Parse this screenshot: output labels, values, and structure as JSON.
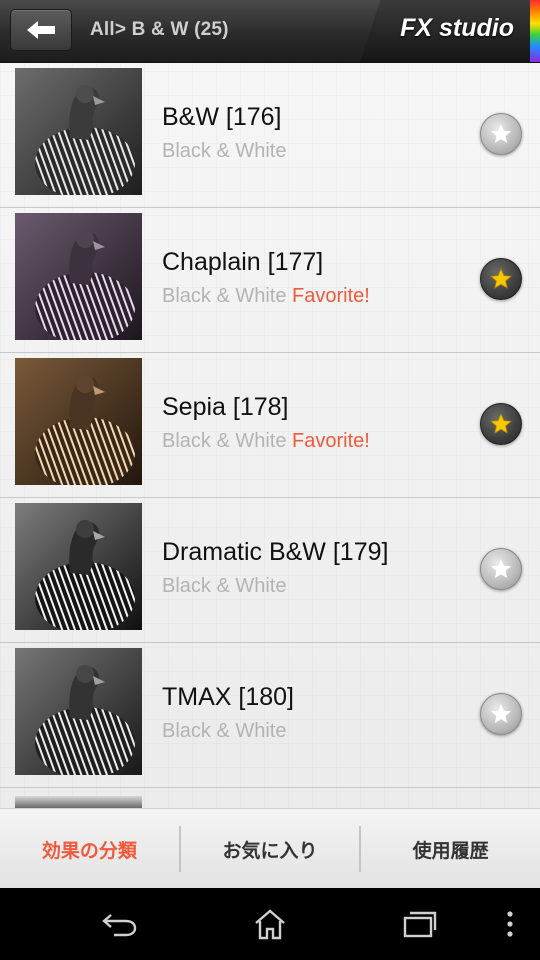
{
  "header": {
    "back_icon": "back-arrow-icon",
    "breadcrumb": "All> B & W (25)",
    "app_title": "FX studio"
  },
  "list": {
    "items": [
      {
        "title": "B&W [176]",
        "category": "Black & White",
        "favorite_label": "",
        "starred": false,
        "tint": "gray"
      },
      {
        "title": "Chaplain [177]",
        "category": "Black & White",
        "favorite_label": "Favorite!",
        "starred": true,
        "tint": "purple"
      },
      {
        "title": "Sepia [178]",
        "category": "Black & White",
        "favorite_label": "Favorite!",
        "starred": true,
        "tint": "sepia"
      },
      {
        "title": "Dramatic B&W [179]",
        "category": "Black & White",
        "favorite_label": "",
        "starred": false,
        "tint": "gray"
      },
      {
        "title": "TMAX [180]",
        "category": "Black & White",
        "favorite_label": "",
        "starred": false,
        "tint": "gray"
      }
    ]
  },
  "tabs": {
    "items": [
      {
        "label": "効果の分類",
        "active": true
      },
      {
        "label": "お気に入り",
        "active": false
      },
      {
        "label": "使用履歴",
        "active": false
      }
    ]
  },
  "navbar": {
    "buttons": [
      "back-icon",
      "home-icon",
      "recent-apps-icon",
      "menu-icon"
    ]
  },
  "colors": {
    "accent": "#f05a3c",
    "star_gold": "#f7c700",
    "subtitle_gray": "#b3b3b3"
  }
}
